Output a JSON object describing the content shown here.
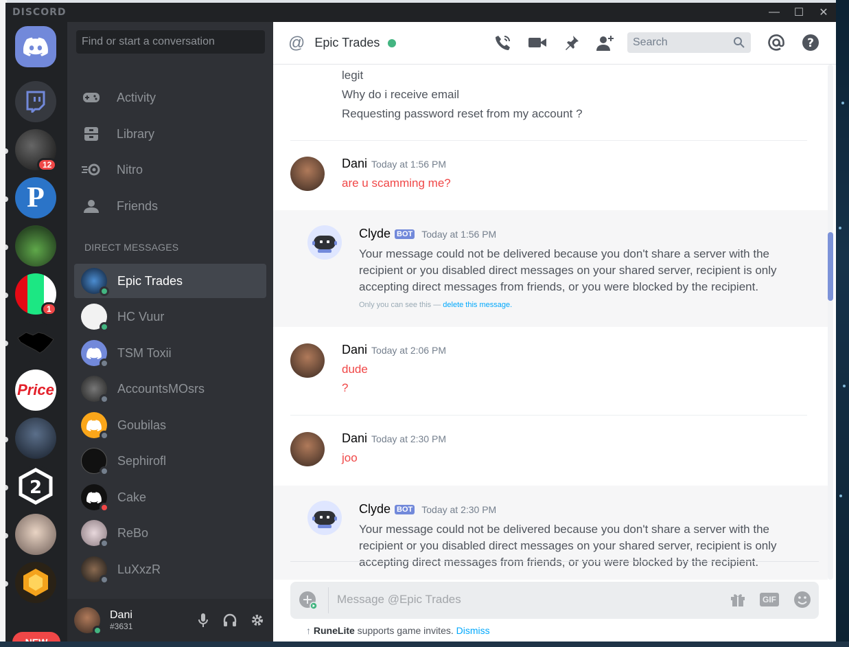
{
  "app": {
    "title": "DISCORD"
  },
  "window_controls": {
    "minimize": "—",
    "maximize": "☐",
    "close": "✕"
  },
  "servers": [
    {
      "name": "home",
      "badge": ""
    },
    {
      "name": "twitch",
      "badge": ""
    },
    {
      "name": "server-dark",
      "badge": "12"
    },
    {
      "name": "P",
      "badge": ""
    },
    {
      "name": "pepe",
      "badge": ""
    },
    {
      "name": "hulu-amazon",
      "badge": "1"
    },
    {
      "name": "handshake",
      "badge": ""
    },
    {
      "name": "Price",
      "badge": ""
    },
    {
      "name": "hooded",
      "badge": ""
    },
    {
      "name": "2",
      "badge": ""
    },
    {
      "name": "portrait",
      "badge": ""
    },
    {
      "name": "hex-orange",
      "badge": ""
    }
  ],
  "new_pill": "NEW",
  "sidebar": {
    "search_placeholder": "Find or start a conversation",
    "nav": [
      {
        "label": "Activity",
        "icon": "gamepad-icon"
      },
      {
        "label": "Library",
        "icon": "library-icon"
      },
      {
        "label": "Nitro",
        "icon": "nitro-icon"
      },
      {
        "label": "Friends",
        "icon": "friends-icon"
      }
    ],
    "dm_header": "DIRECT MESSAGES",
    "dms": [
      {
        "name": "Epic Trades",
        "status": "online",
        "active": true
      },
      {
        "name": "HC Vuur",
        "status": "online"
      },
      {
        "name": "TSM Toxii",
        "status": "offline"
      },
      {
        "name": "AccountsMOsrs",
        "status": "offline"
      },
      {
        "name": "Goubilas",
        "status": "offline"
      },
      {
        "name": "Sephirofl",
        "status": "offline"
      },
      {
        "name": "Cake",
        "status": "dnd"
      },
      {
        "name": "ReBo",
        "status": "offline"
      },
      {
        "name": "LuXxzR",
        "status": "offline"
      }
    ]
  },
  "user": {
    "name": "Dani",
    "tag": "#3631"
  },
  "chat": {
    "channel_symbol": "@",
    "channel_name": "Epic Trades",
    "search_placeholder": "Search",
    "prev_lines": [
      "legit",
      "Why do i receive  email",
      "Requesting password reset from my account ?"
    ],
    "msgs": [
      {
        "author": "Dani",
        "time": "Today at 1:56 PM",
        "lines": [
          "are u scamming me?"
        ]
      },
      {
        "author": "Dani",
        "time": "Today at 2:06 PM",
        "lines": [
          "dude",
          "?"
        ]
      },
      {
        "author": "Dani",
        "time": "Today at 2:30 PM",
        "lines": [
          "joo"
        ]
      }
    ],
    "bot1": {
      "author": "Clyde",
      "tag": "BOT",
      "time": "Today at 1:56 PM",
      "lines": [
        "Your message could not be delivered because you don't share a server with the",
        "recipient or you disabled direct messages on your shared server, recipient is only",
        "accepting direct messages from friends, or you were blocked by the recipient."
      ],
      "note": "Only you can see this — ",
      "note_link": "delete this message."
    },
    "bot2": {
      "author": "Clyde",
      "tag": "BOT",
      "time": "Today at 2:30 PM",
      "lines": [
        "Your message could not be delivered because you don't share a server with the",
        "recipient or you disabled direct messages on your shared server, recipient is only",
        "accepting direct messages from friends, or you were blocked by the recipient."
      ]
    },
    "composer_placeholder": "Message @Epic Trades",
    "gif_label": "GIF",
    "tip": {
      "brand": "RuneLite",
      "text": " supports game invites. ",
      "link": "Dismiss"
    }
  }
}
